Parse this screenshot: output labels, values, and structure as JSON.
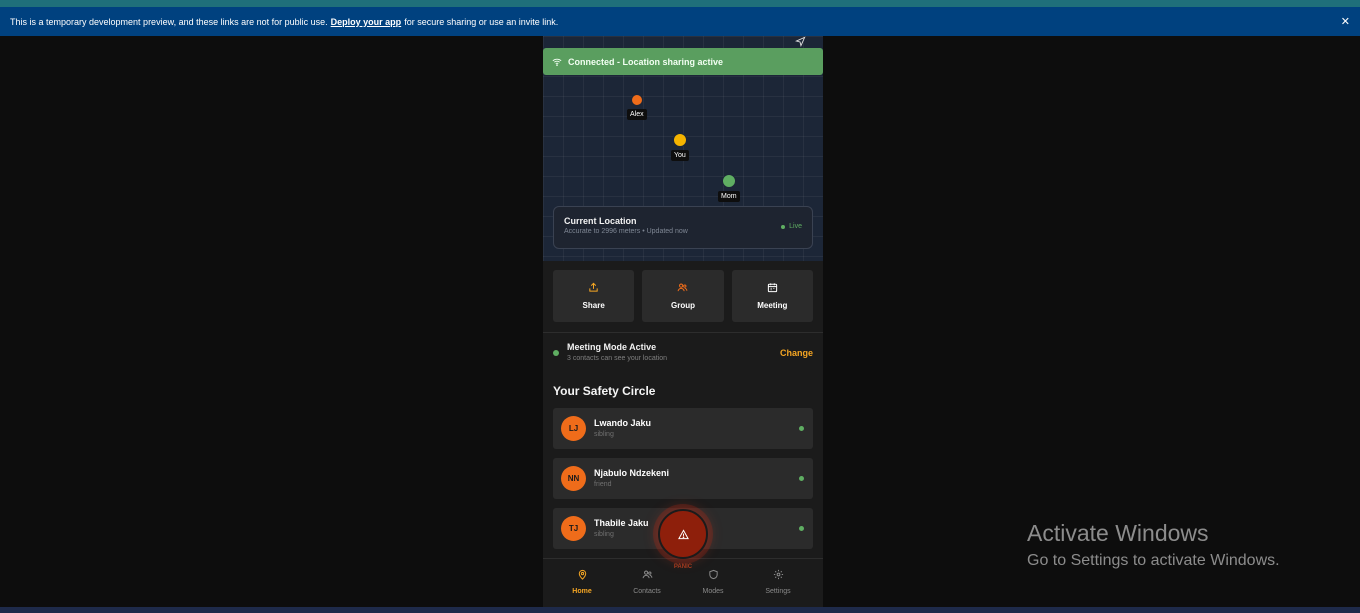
{
  "banner": {
    "text_before": "This is a temporary development preview, and these links are not for public use.",
    "link_text": "Deploy your app",
    "text_after": "for secure sharing or use an invite link.",
    "close_glyph": "✕"
  },
  "map": {
    "connection_status": "Connected - Location sharing active",
    "pins": [
      {
        "label": "Alex",
        "color": "#ef6c1a"
      },
      {
        "label": "You",
        "color": "#f5b400"
      },
      {
        "label": "Mom",
        "color": "#5fae62"
      }
    ],
    "current_location": {
      "title": "Current Location",
      "subtitle": "Accurate to 2996 meters • Updated now",
      "live_label": "Live"
    }
  },
  "actions": [
    {
      "label": "Share",
      "icon": "share-icon"
    },
    {
      "label": "Group",
      "icon": "group-icon"
    },
    {
      "label": "Meeting",
      "icon": "calendar-icon"
    }
  ],
  "meeting_mode": {
    "title": "Meeting Mode Active",
    "subtitle": "3 contacts can see your location",
    "change_label": "Change"
  },
  "safety_circle": {
    "title": "Your Safety Circle",
    "contacts": [
      {
        "initials": "LJ",
        "name": "Lwando Jaku",
        "relation": "sibling"
      },
      {
        "initials": "NN",
        "name": "Njabulo Ndzekeni",
        "relation": "friend"
      },
      {
        "initials": "TJ",
        "name": "Thabile Jaku",
        "relation": "sibling"
      }
    ]
  },
  "panic": {
    "label": "PANIC",
    "icon": "warning-icon"
  },
  "bottom_nav": [
    {
      "label": "Home",
      "icon": "location-pin-icon",
      "active": true
    },
    {
      "label": "Contacts",
      "icon": "contacts-icon",
      "active": false
    },
    {
      "label": "Modes",
      "icon": "shield-icon",
      "active": false
    },
    {
      "label": "Settings",
      "icon": "gear-icon",
      "active": false
    }
  ],
  "watermark": {
    "line1": "Activate Windows",
    "line2": "Go to Settings to activate Windows."
  },
  "colors": {
    "accent": "#f5a623",
    "connected_green": "#5a9e5f",
    "avatar_orange": "#ef6c1a",
    "panic_red": "#8e1f0b",
    "banner_blue": "#00417f"
  }
}
